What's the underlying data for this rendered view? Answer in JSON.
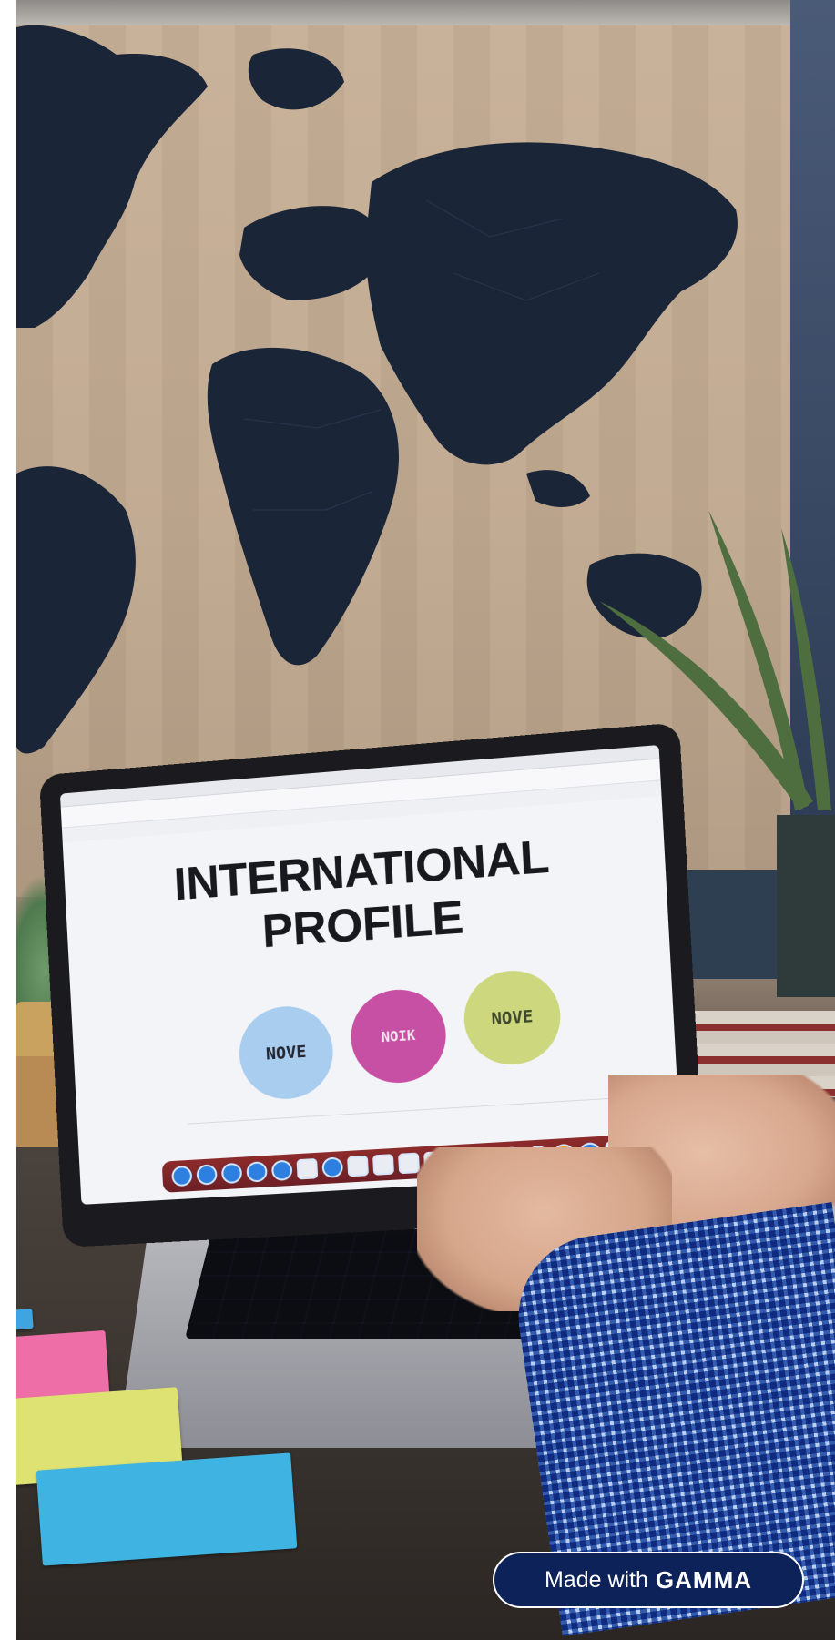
{
  "screen": {
    "title_line1": "INTERNATIONAL",
    "title_line2": "PROFILE",
    "circles": [
      {
        "label": "NOVE",
        "color": "#a9cdef"
      },
      {
        "label": "NOIK",
        "color": "#c74fa4"
      },
      {
        "label": "NOVE",
        "color": "#ccd77e"
      }
    ]
  },
  "badge": {
    "prefix": "Made with",
    "brand": "GAMMA",
    "background": "#0d2259"
  },
  "colors": {
    "map_land": "#1b2538",
    "tapestry": "#c2ab92",
    "sleeve": "#3d67b4"
  }
}
